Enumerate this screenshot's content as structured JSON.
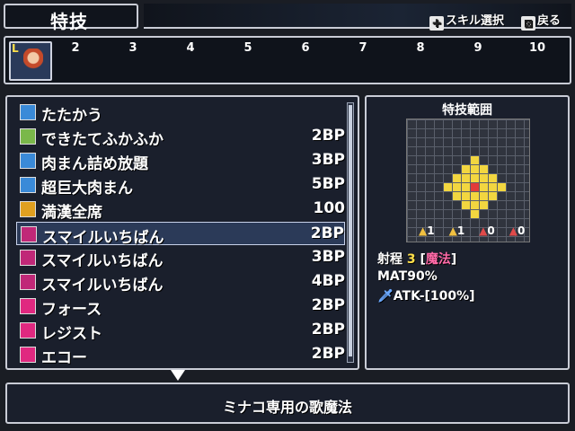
{
  "header": {
    "title": "特技",
    "skill_select_hint": "スキル選択",
    "back_hint": "戻る",
    "skill_select_icon": "dpad-icon",
    "back_icon": "cross-button-icon"
  },
  "party": {
    "portrait_level": "L",
    "slots": [
      "2",
      "3",
      "4",
      "5",
      "6",
      "7",
      "8",
      "9",
      "10"
    ]
  },
  "skills": [
    {
      "name": "たたかう",
      "cost": "",
      "icon": "sword-icon",
      "icon_color": "#3a8ad8"
    },
    {
      "name": "できたてふかふか",
      "cost": "2BP",
      "icon": "heal-icon",
      "icon_color": "#7ab84a"
    },
    {
      "name": "肉まん詰め放題",
      "cost": "3BP",
      "icon": "square-icon",
      "icon_color": "#3a8ad8"
    },
    {
      "name": "超巨大肉まん",
      "cost": "5BP",
      "icon": "square-icon",
      "icon_color": "#3a8ad8"
    },
    {
      "name": "満漢全席",
      "cost": "100",
      "icon": "special-icon",
      "icon_color": "#e0a020"
    },
    {
      "name": "スマイルいちばん",
      "cost": "2BP",
      "icon": "music-icon",
      "icon_color": "#c02878"
    },
    {
      "name": "スマイルいちばん",
      "cost": "3BP",
      "icon": "music-plus-icon",
      "icon_color": "#c02878"
    },
    {
      "name": "スマイルいちばん",
      "cost": "4BP",
      "icon": "music-plus2-icon",
      "icon_color": "#c02878"
    },
    {
      "name": "フォース",
      "cost": "2BP",
      "icon": "vo-icon",
      "icon_color": "#e02880"
    },
    {
      "name": "レジスト",
      "cost": "2BP",
      "icon": "vo-icon",
      "icon_color": "#e02880"
    },
    {
      "name": "エコー",
      "cost": "2BP",
      "icon": "vo-icon",
      "icon_color": "#e02880"
    }
  ],
  "selected_index": 5,
  "range_panel": {
    "title": "特技範囲",
    "elements": [
      "1",
      "1",
      "0",
      "0"
    ],
    "range_label": "射程",
    "range_value": "3",
    "range_type_open": "[",
    "range_type": "魔法",
    "range_type_close": "]",
    "mat": "MAT90%",
    "atk": "ATK-[100%]"
  },
  "description": "ミナコ専用の歌魔法",
  "colors": {
    "accent_yellow": "#ffe04a",
    "accent_pink": "#ff6aa8",
    "range_cell": "#f2d640",
    "range_center": "#e23a3a"
  }
}
